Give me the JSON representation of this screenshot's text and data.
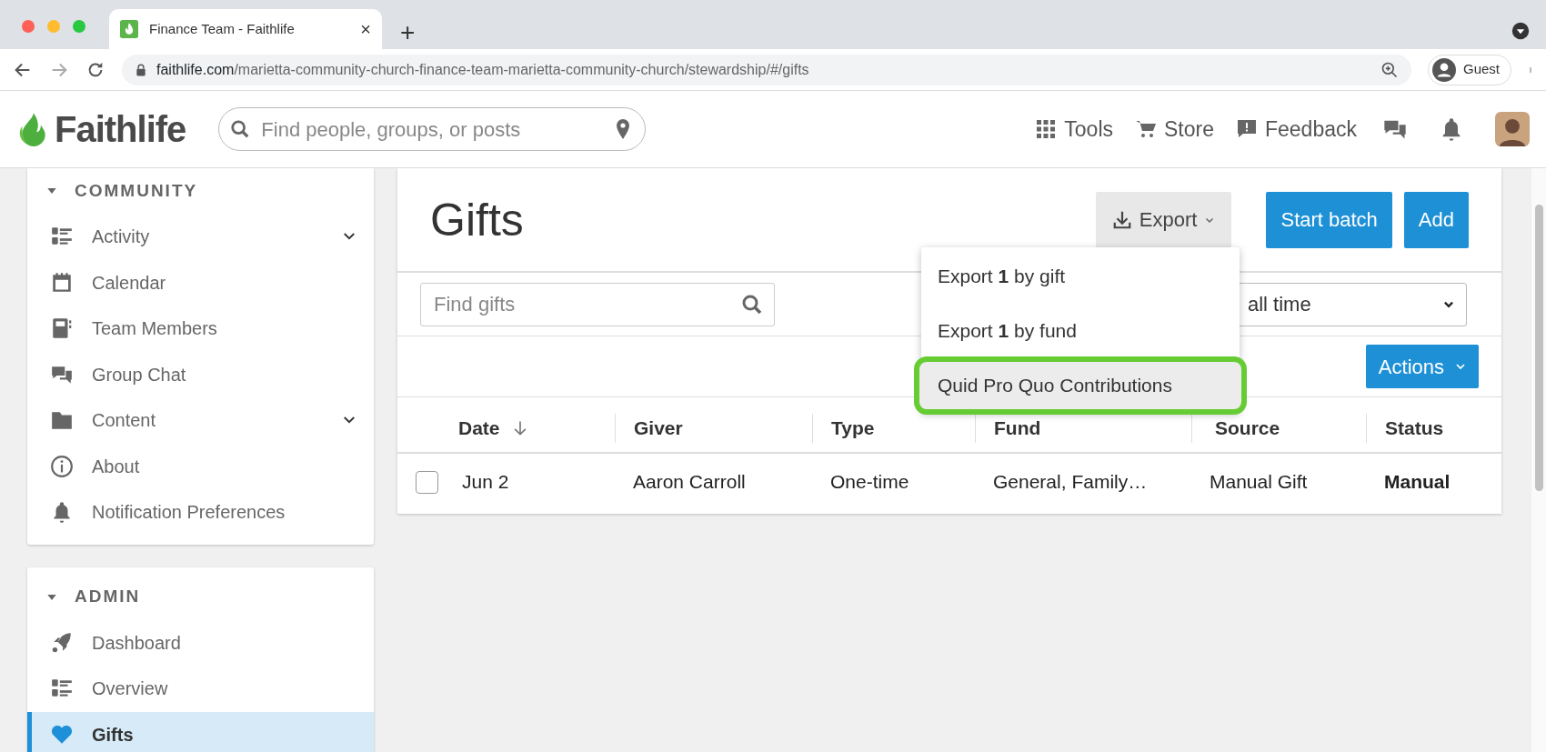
{
  "browser": {
    "tab_title": "Finance Team - Faithlife",
    "tab_close": "×",
    "new_tab": "+",
    "url_host": "faithlife.com",
    "url_path": "/marietta-community-church-finance-team-marietta-community-church/stewardship/#/gifts",
    "profile": "Guest"
  },
  "header": {
    "logo": "Faithlife",
    "search_placeholder": "Find people, groups, or posts",
    "nav": [
      "Tools",
      "Store",
      "Feedback"
    ]
  },
  "sidebar": [
    {
      "title": "COMMUNITY",
      "expanded": true,
      "items": [
        {
          "label": "Activity",
          "has_submenu": true,
          "selected": false
        },
        {
          "label": "Calendar",
          "has_submenu": false,
          "selected": false
        },
        {
          "label": "Team Members",
          "has_submenu": false,
          "selected": false
        },
        {
          "label": "Group Chat",
          "has_submenu": false,
          "selected": false
        },
        {
          "label": "Content",
          "has_submenu": true,
          "selected": false
        },
        {
          "label": "About",
          "has_submenu": false,
          "selected": false
        },
        {
          "label": "Notification Preferences",
          "has_submenu": false,
          "selected": false
        }
      ]
    },
    {
      "title": "ADMIN",
      "expanded": true,
      "items": [
        {
          "label": "Dashboard",
          "has_submenu": false,
          "selected": false
        },
        {
          "label": "Overview",
          "has_submenu": false,
          "selected": false
        },
        {
          "label": "Gifts",
          "has_submenu": false,
          "selected": true
        }
      ]
    }
  ],
  "main": {
    "title": "Gifts",
    "export_button": "Export",
    "buttons": [
      "Start batch",
      "Add"
    ],
    "export_menu": [
      {
        "text": "Export **1** by gift",
        "highlighted": false
      },
      {
        "text": "Export **1** by fund",
        "highlighted": false
      },
      {
        "text": "Quid Pro Quo Contributions",
        "highlighted": true
      }
    ],
    "search_placeholder": "Find gifts",
    "date_filter": "all time",
    "actions_button": "Actions",
    "table": {
      "columns": [
        {
          "label": "Date",
          "sorted": true
        },
        {
          "label": "Giver",
          "sorted": false
        },
        {
          "label": "Type",
          "sorted": false
        },
        {
          "label": "Fund",
          "sorted": false
        },
        {
          "label": "Source",
          "sorted": false
        },
        {
          "label": "Status",
          "sorted": false
        }
      ],
      "rows": [
        {
          "selected": false,
          "cells": [
            "Jun 2",
            "Aaron Carroll",
            "One-time",
            "General, Family…",
            "Manual Gift",
            "Manual"
          ]
        }
      ]
    }
  }
}
